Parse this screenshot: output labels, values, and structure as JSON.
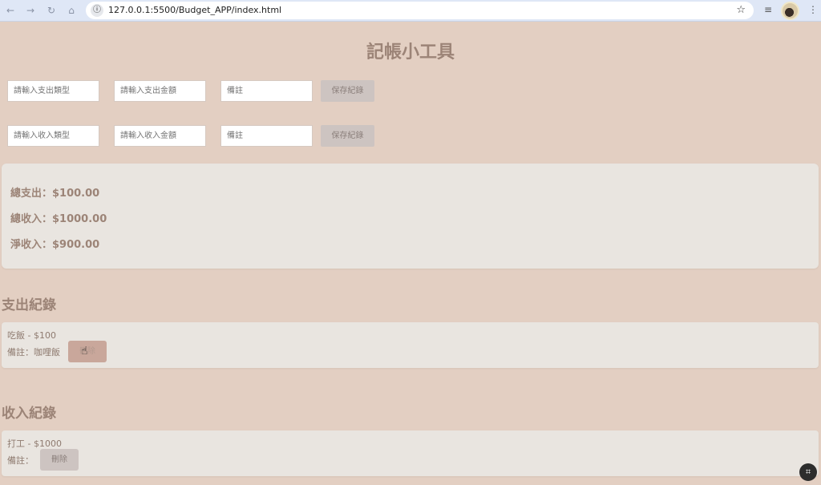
{
  "browser": {
    "url": "127.0.0.1:5500/Budget_APP/index.html",
    "icons": {
      "back": "arrow-left-icon",
      "forward": "arrow-right-icon",
      "reload": "reload-icon",
      "home": "home-icon",
      "info": "info-icon",
      "bookmark": "star-icon",
      "media": "media-controls-icon",
      "menu": "kebab-menu-icon"
    }
  },
  "page": {
    "title": "記帳小工具"
  },
  "expense_form": {
    "type_placeholder": "請輸入支出類型",
    "amount_placeholder": "請輸入支出金額",
    "note_placeholder": "備註",
    "save_label": "保存紀錄"
  },
  "income_form": {
    "type_placeholder": "請輸入收入類型",
    "amount_placeholder": "請輸入收入金額",
    "note_placeholder": "備註",
    "save_label": "保存紀錄"
  },
  "summary": {
    "total_expense": "總支出：$100.00",
    "total_income": "總收入：$1000.00",
    "net_income": "淨收入：$900.00"
  },
  "expense_records": {
    "title": "支出紀錄",
    "items": [
      {
        "line": "吃飯 - $100",
        "note": "備註：咖哩飯",
        "delete_label": "刪除"
      }
    ]
  },
  "income_records": {
    "title": "收入紀錄",
    "items": [
      {
        "line": "打工 - $1000",
        "note": "備註：",
        "delete_label": "刪除"
      }
    ]
  },
  "colors": {
    "background": "#e3cfc2",
    "accent_text": "#9c8477",
    "card": "#e9e5e0",
    "delete_hover": "#c9a79b"
  }
}
